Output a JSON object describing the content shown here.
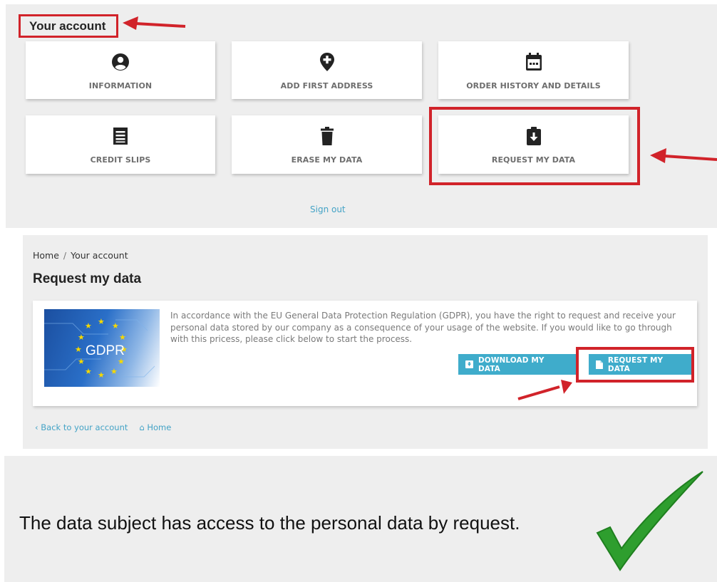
{
  "account": {
    "title": "Your account",
    "tiles": [
      {
        "label": "INFORMATION",
        "icon": "user-circle-icon"
      },
      {
        "label": "ADD FIRST ADDRESS",
        "icon": "map-pin-plus-icon"
      },
      {
        "label": "ORDER HISTORY AND DETAILS",
        "icon": "calendar-icon"
      },
      {
        "label": "CREDIT SLIPS",
        "icon": "receipt-icon"
      },
      {
        "label": "ERASE MY DATA",
        "icon": "trash-icon"
      },
      {
        "label": "REQUEST MY DATA",
        "icon": "clipboard-download-icon"
      }
    ],
    "sign_out": "Sign out"
  },
  "request_page": {
    "breadcrumb": {
      "home": "Home",
      "separator": "/",
      "current": "Your account"
    },
    "title": "Request my data",
    "image_label": "GDPR",
    "description": "In accordance with the EU General Data Protection Regulation (GDPR), you have the right to request and receive your personal data stored by our company as a consequence of your usage of the website. If you would like to go through with this pricess, please click below to start the process.",
    "download_button": "DOWNLOAD MY DATA",
    "request_button": "REQUEST MY DATA",
    "back_link": "Back to your account",
    "home_link": "Home"
  },
  "conclusion": {
    "text": "The data subject has access to the personal data by request."
  },
  "colors": {
    "highlight_red": "#d1232a",
    "accent_blue": "#3faccb",
    "link_blue": "#44a3c6",
    "check_green": "#2e9e2e",
    "panel_gray": "#eeeeee"
  }
}
